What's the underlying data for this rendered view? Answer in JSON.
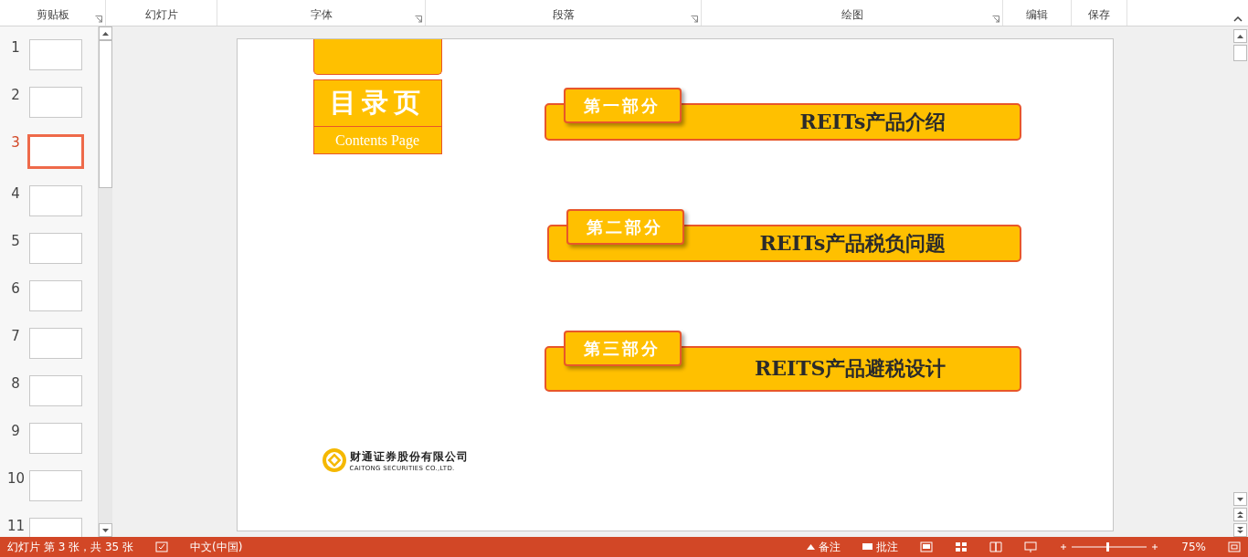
{
  "ribbon": {
    "groups": [
      {
        "label": "剪贴板",
        "launcher": true
      },
      {
        "label": "幻灯片",
        "launcher": false
      },
      {
        "label": "字体",
        "launcher": true
      },
      {
        "label": "段落",
        "launcher": true
      },
      {
        "label": "绘图",
        "launcher": true
      },
      {
        "label": "编辑",
        "launcher": false
      },
      {
        "label": "保存",
        "launcher": false
      }
    ]
  },
  "thumbnails": [
    {
      "number": "1",
      "selected": false
    },
    {
      "number": "2",
      "selected": false
    },
    {
      "number": "3",
      "selected": true
    },
    {
      "number": "4",
      "selected": false
    },
    {
      "number": "5",
      "selected": false
    },
    {
      "number": "6",
      "selected": false
    },
    {
      "number": "7",
      "selected": false
    },
    {
      "number": "8",
      "selected": false
    },
    {
      "number": "9",
      "selected": false
    },
    {
      "number": "10",
      "selected": false
    },
    {
      "number": "11",
      "selected": false
    }
  ],
  "slide": {
    "title": "目录页",
    "subtitle": "Contents Page",
    "sections": [
      {
        "tab": "第一部分",
        "title": "REITs产品介绍"
      },
      {
        "tab": "第二部分",
        "title": "REITs产品税负问题"
      },
      {
        "tab": "第三部分",
        "title": "REITS产品避税设计"
      }
    ],
    "logo": {
      "name": "财通证券股份有限公司",
      "english": "CAITONG SECURITIES CO.,LTD."
    }
  },
  "status_bar": {
    "slide_info": "幻灯片 第 3 张，共 35 张",
    "language": "中文(中国)",
    "notes": "备注",
    "comments": "批注",
    "zoom": "75%"
  }
}
